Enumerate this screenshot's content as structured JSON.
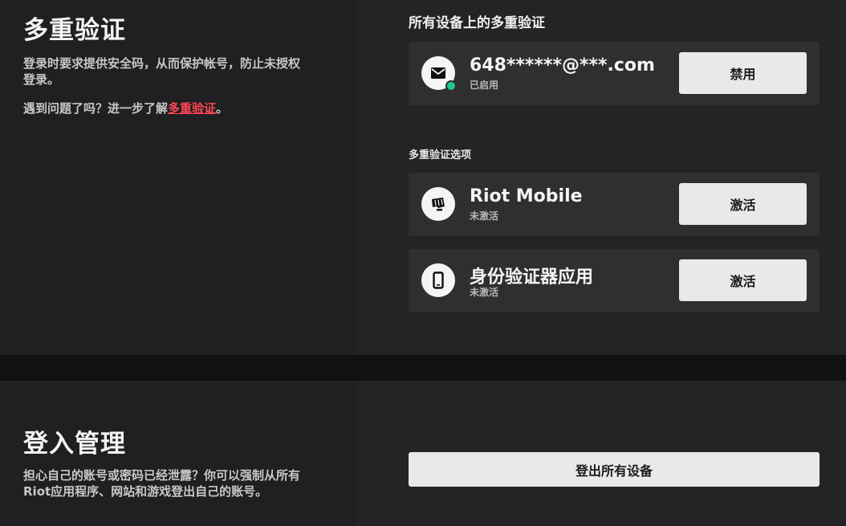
{
  "mfa": {
    "title": "多重验证",
    "description": "登录时要求提供安全码，从而保护帐号，防止未授权登录。",
    "help_prefix": "遇到问题了吗？进一步了解",
    "help_link": "多重验证",
    "help_suffix": "。",
    "all_devices_title": "所有设备上的多重验证",
    "email_method": {
      "value": "648******@***.com",
      "status": "已启用",
      "button": "禁用",
      "icon": "mail-icon",
      "status_color": "#1ec98c"
    },
    "options_title": "多重验证选项",
    "options": [
      {
        "name": "Riot Mobile",
        "status": "未激活",
        "button": "激活",
        "icon": "riot-fist-icon"
      },
      {
        "name": "身份验证器应用",
        "status": "未激活",
        "button": "激活",
        "icon": "smartphone-icon"
      }
    ]
  },
  "login": {
    "title": "登入管理",
    "description": "担心自己的账号或密码已经泄露？你可以强制从所有Riot应用程序、网站和游戏登出自己的账号。",
    "logout_button": "登出所有设备"
  },
  "colors": {
    "accent_link": "#ff4655",
    "button_bg": "#e9e9e9",
    "card_bg": "#2f2e31"
  }
}
